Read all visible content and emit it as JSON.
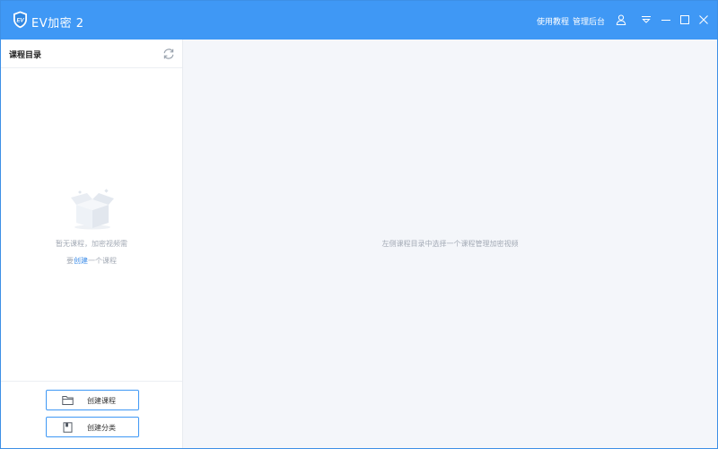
{
  "app": {
    "title": "EV加密 2",
    "logo_text": "EV"
  },
  "header": {
    "links": {
      "tutorial": "使用教程",
      "admin": "管理后台"
    },
    "icons": [
      "user-icon",
      "dropdown-menu-icon",
      "minimize-icon",
      "maximize-icon",
      "close-icon"
    ]
  },
  "sidebar": {
    "title": "课程目录",
    "empty": {
      "message": "暂无课程，加密视频需",
      "hint_prefix": "要",
      "hint_link": "创建",
      "hint_suffix": "一个课程"
    },
    "buttons": {
      "create_course": "创建课程",
      "create_category": "创建分类"
    }
  },
  "main": {
    "hint": "左侧课程目录中选择一个课程管理加密视频"
  },
  "colors": {
    "titlebar": "#3f98f5",
    "accent": "#3f98f5",
    "link": "#3f8ee8",
    "main_bg": "#f4f6fa",
    "muted_text": "#a4abb6"
  }
}
